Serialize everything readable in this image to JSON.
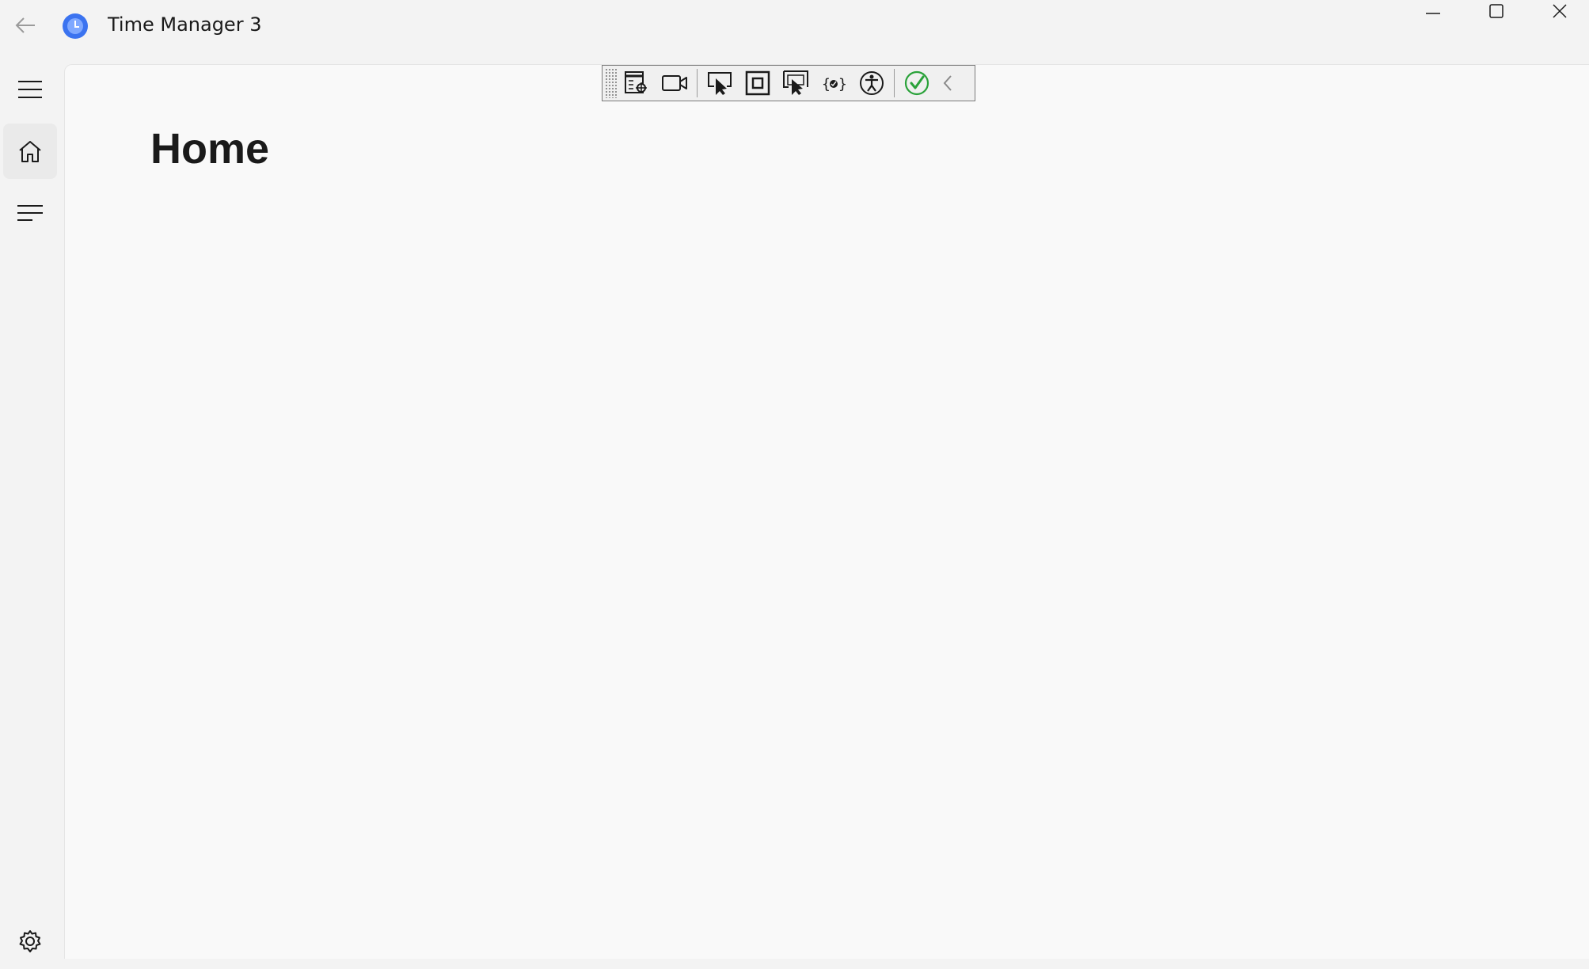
{
  "window": {
    "title": "Time Manager 3"
  },
  "page": {
    "title": "Home"
  },
  "icons": {
    "back": "arrow-left-icon",
    "app": "clock-icon",
    "minimize": "minimize-icon",
    "maximize": "maximize-icon",
    "close": "close-icon",
    "menu": "hamburger-icon",
    "home": "home-icon",
    "list": "list-icon",
    "settings": "gear-icon"
  },
  "colors": {
    "accent": "#3b73f0",
    "check_green": "#2aa23a"
  }
}
